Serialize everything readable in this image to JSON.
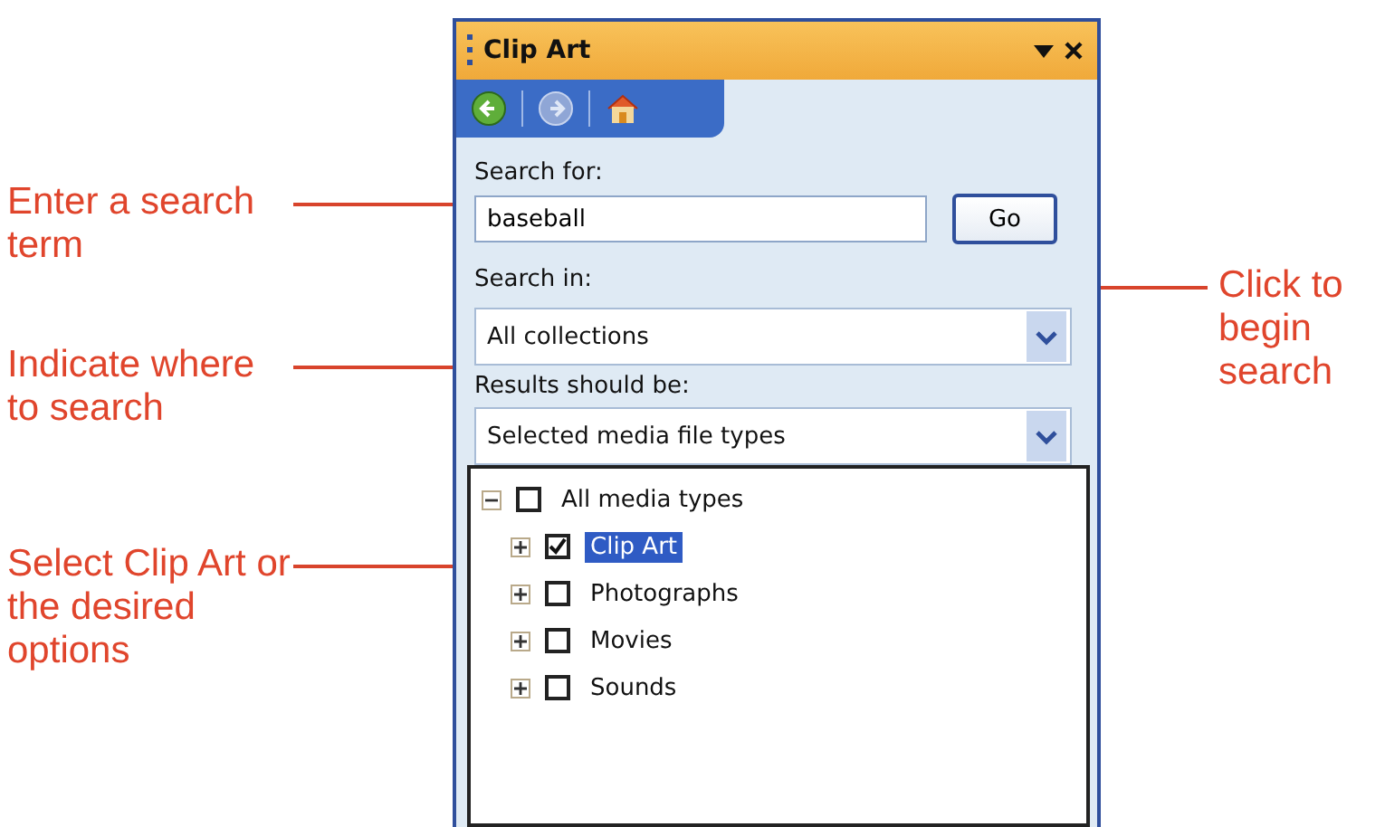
{
  "callouts_left": [
    {
      "text": "Enter a search term"
    },
    {
      "text": "Indicate where to search"
    },
    {
      "text": "Select Clip Art or the desired options"
    }
  ],
  "callouts_right": [
    {
      "text": "Click to begin search"
    }
  ],
  "panel": {
    "title": "Clip Art",
    "search_for": {
      "label": "Search for:",
      "value": "baseball",
      "button": "Go"
    },
    "search_in": {
      "label": "Search in:",
      "value": "All collections"
    },
    "results": {
      "label": "Results should be:",
      "value": "Selected media file types"
    },
    "tree": {
      "label": "All media types",
      "checked": false,
      "expanded": true,
      "children": [
        {
          "label": "Clip Art",
          "checked": true,
          "selected": true,
          "expanded": false
        },
        {
          "label": "Photographs",
          "checked": false,
          "selected": false,
          "expanded": false
        },
        {
          "label": "Movies",
          "checked": false,
          "selected": false,
          "expanded": false
        },
        {
          "label": "Sounds",
          "checked": false,
          "selected": false,
          "expanded": false
        }
      ]
    }
  }
}
